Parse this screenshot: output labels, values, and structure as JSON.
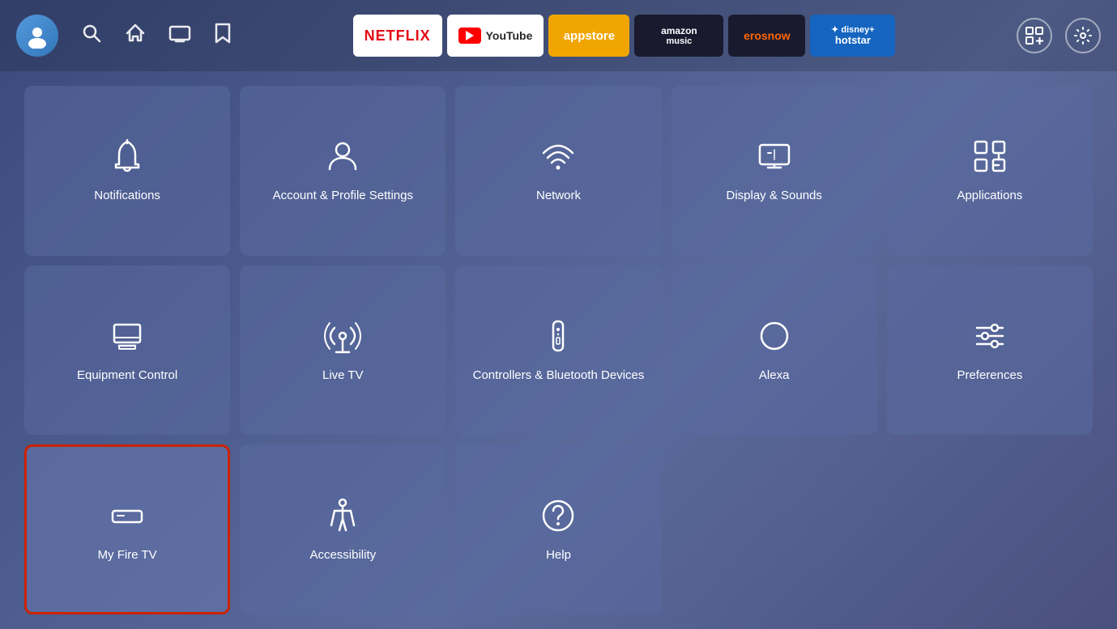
{
  "nav": {
    "apps": [
      {
        "id": "netflix",
        "label": "NETFLIX"
      },
      {
        "id": "youtube",
        "label": "YouTube"
      },
      {
        "id": "appstore",
        "label": "appstore"
      },
      {
        "id": "amazonmusic",
        "label": "amazon music"
      },
      {
        "id": "erosnow",
        "label": "erosnow"
      },
      {
        "id": "hotstar",
        "label": "disney+ hotstar"
      }
    ]
  },
  "tiles": [
    {
      "id": "notifications",
      "label": "Notifications",
      "icon": "bell"
    },
    {
      "id": "account-profile",
      "label": "Account & Profile Settings",
      "icon": "person"
    },
    {
      "id": "network",
      "label": "Network",
      "icon": "wifi"
    },
    {
      "id": "display-sounds",
      "label": "Display & Sounds",
      "icon": "display"
    },
    {
      "id": "applications",
      "label": "Applications",
      "icon": "apps"
    },
    {
      "id": "equipment-control",
      "label": "Equipment Control",
      "icon": "monitor"
    },
    {
      "id": "live-tv",
      "label": "Live TV",
      "icon": "tower"
    },
    {
      "id": "controllers-bluetooth",
      "label": "Controllers & Bluetooth Devices",
      "icon": "remote"
    },
    {
      "id": "alexa",
      "label": "Alexa",
      "icon": "alexa"
    },
    {
      "id": "preferences",
      "label": "Preferences",
      "icon": "sliders"
    },
    {
      "id": "my-fire-tv",
      "label": "My Fire TV",
      "icon": "firetv",
      "selected": true
    },
    {
      "id": "accessibility",
      "label": "Accessibility",
      "icon": "accessibility"
    },
    {
      "id": "help",
      "label": "Help",
      "icon": "help"
    },
    {
      "id": "empty1",
      "label": "",
      "icon": ""
    },
    {
      "id": "empty2",
      "label": "",
      "icon": ""
    }
  ]
}
